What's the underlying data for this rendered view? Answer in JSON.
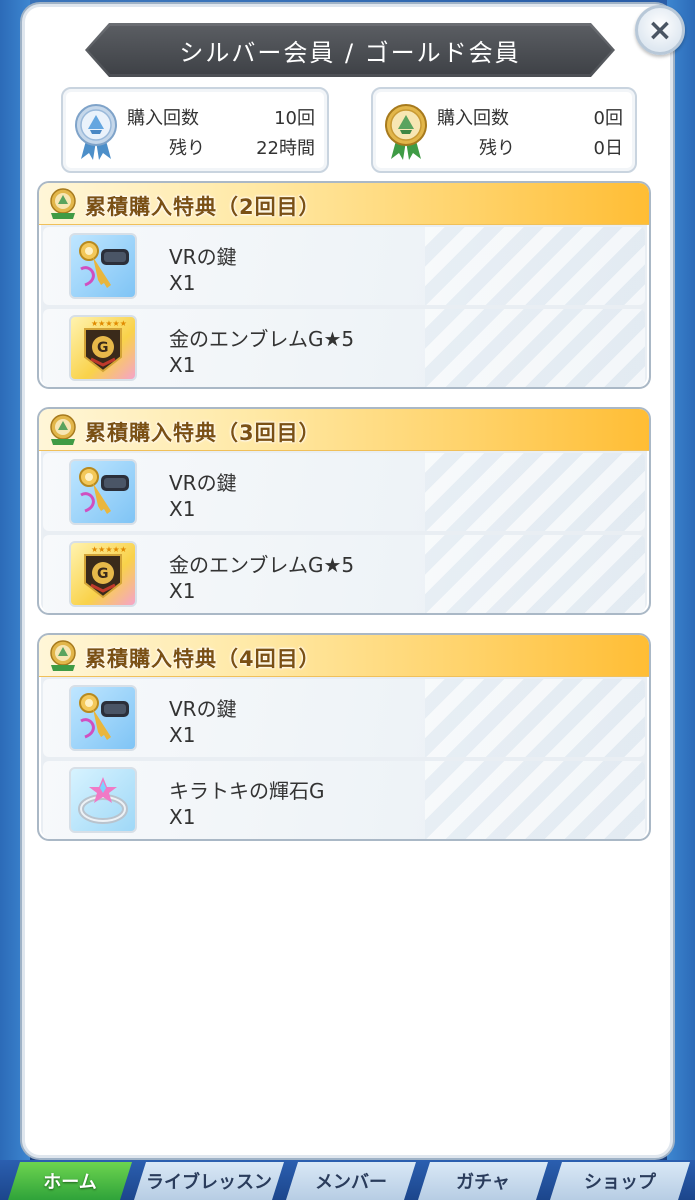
{
  "modal": {
    "title": "シルバー会員 / ゴールド会員",
    "close_label": "×"
  },
  "status": {
    "silver": {
      "purchases_label": "購入回数",
      "purchases_value": "10回",
      "remaining_label": "残り",
      "remaining_value": "22時間"
    },
    "gold": {
      "purchases_label": "購入回数",
      "purchases_value": "0回",
      "remaining_label": "残り",
      "remaining_value": "0日"
    }
  },
  "groups": [
    {
      "title": "累積購入特典（2回目）",
      "items": [
        {
          "name": "VRの鍵",
          "qty": "X1",
          "icon": "vr-key-icon"
        },
        {
          "name": "金のエンブレムG★5",
          "qty": "X1",
          "icon": "gold-emblem-icon"
        }
      ]
    },
    {
      "title": "累積購入特典（3回目）",
      "items": [
        {
          "name": "VRの鍵",
          "qty": "X1",
          "icon": "vr-key-icon"
        },
        {
          "name": "金のエンブレムG★5",
          "qty": "X1",
          "icon": "gold-emblem-icon"
        }
      ]
    },
    {
      "title": "累積購入特典（4回目）",
      "items": [
        {
          "name": "VRの鍵",
          "qty": "X1",
          "icon": "vr-key-icon"
        },
        {
          "name": "キラトキの輝石G",
          "qty": "X1",
          "icon": "sparkle-ring-icon"
        }
      ]
    }
  ],
  "bottom_nav": {
    "tabs": [
      "ホーム",
      "ライブレッスン",
      "メンバー",
      "ガチャ",
      "ショップ"
    ],
    "active": "ホーム"
  },
  "colors": {
    "header_gold": "#ffbd34",
    "title_banner": "#4c4f54",
    "nav_active": "#2fa33a"
  }
}
